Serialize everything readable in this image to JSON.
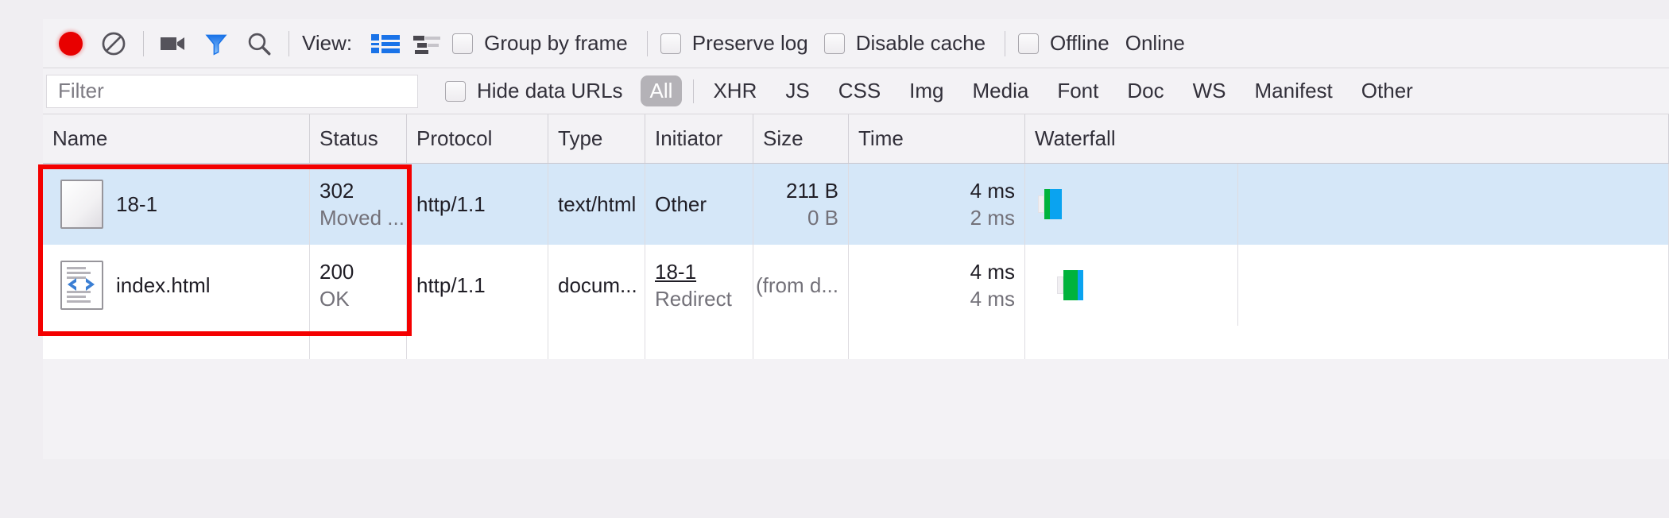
{
  "toolbar": {
    "record_icon": "record-circle-icon",
    "clear_icon": "clear-prohibited-icon",
    "camera_icon": "camera-filmstrip-icon",
    "filter_icon": "funnel-filter-icon",
    "search_icon": "magnifier-search-icon",
    "view_label": "View:",
    "view_list_icon": "list-view-icon",
    "view_waterfall_icon": "waterfall-view-icon",
    "group_by_frame": "Group by frame",
    "preserve_log": "Preserve log",
    "disable_cache": "Disable cache",
    "offline": "Offline",
    "online": "Online"
  },
  "filterbar": {
    "filter_placeholder": "Filter",
    "filter_value": "",
    "hide_data_urls": "Hide data URLs",
    "types": [
      {
        "label": "All",
        "active": true
      },
      {
        "label": "XHR",
        "active": false
      },
      {
        "label": "JS",
        "active": false
      },
      {
        "label": "CSS",
        "active": false
      },
      {
        "label": "Img",
        "active": false
      },
      {
        "label": "Media",
        "active": false
      },
      {
        "label": "Font",
        "active": false
      },
      {
        "label": "Doc",
        "active": false
      },
      {
        "label": "WS",
        "active": false
      },
      {
        "label": "Manifest",
        "active": false
      },
      {
        "label": "Other",
        "active": false
      }
    ]
  },
  "table": {
    "columns": [
      "Name",
      "Status",
      "Protocol",
      "Type",
      "Initiator",
      "Size",
      "Time",
      "Waterfall"
    ],
    "rows": [
      {
        "icon": "blank-document-icon",
        "name": "18-1",
        "status_line1": "302",
        "status_line2": "Moved ...",
        "protocol": "http/1.1",
        "type": "text/html",
        "initiator_line1": "Other",
        "initiator_line2": "",
        "initiator_is_link": false,
        "size_line1": "211 B",
        "size_line2": "0 B",
        "time_line1": "4 ms",
        "time_line2": "2 ms",
        "selected": true,
        "waterfall": {
          "offset_pct": 2.0,
          "pre_pct": 1.0,
          "green_pct": 0.8,
          "blue_pct": 1.6
        }
      },
      {
        "icon": "html-code-document-icon",
        "name": "index.html",
        "status_line1": "200",
        "status_line2": "OK",
        "protocol": "http/1.1",
        "type": "docum...",
        "initiator_line1": "18-1",
        "initiator_line2": "Redirect",
        "initiator_is_link": true,
        "size_line1": "",
        "size_line2": "(from d...",
        "time_line1": "4 ms",
        "time_line2": "4 ms",
        "selected": false,
        "waterfall": {
          "offset_pct": 5.0,
          "pre_pct": 1.0,
          "green_pct": 2.0,
          "blue_pct": 0.7
        }
      }
    ]
  },
  "colors": {
    "record_red": "#e80000",
    "accent_blue": "#1a73e8",
    "selected_row": "#d5e7f8",
    "waterfall_green": "#00b33c",
    "waterfall_blue": "#0aa3f0",
    "annotation_red": "#f40000"
  }
}
